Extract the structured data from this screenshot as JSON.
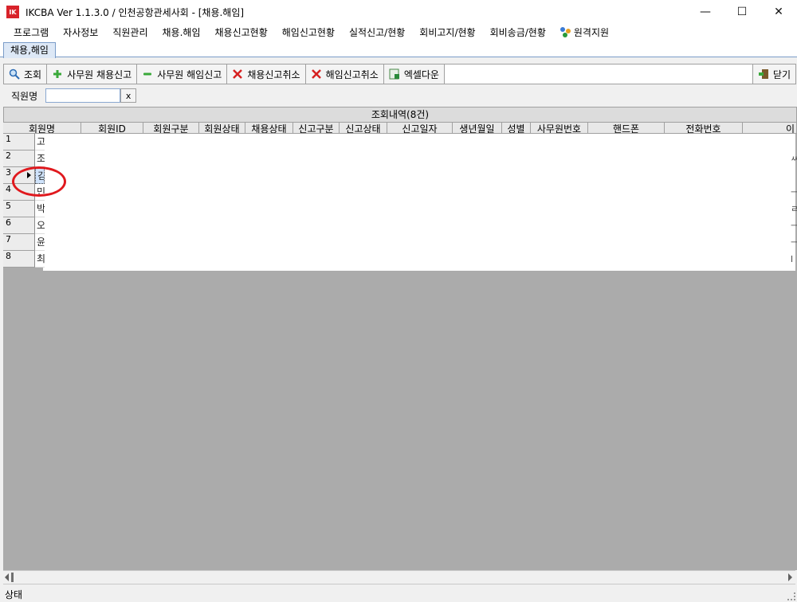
{
  "window": {
    "icon_text": "IK",
    "title": "IKCBA Ver 1.1.3.0 / 인천공항관세사회 - [채용.해임]",
    "minimize": "—",
    "maximize": "☐",
    "close": "✕"
  },
  "menu": [
    "프로그램",
    "자사정보",
    "직원관리",
    "채용.해임",
    "채용신고현황",
    "해임신고현황",
    "실적신고/현황",
    "회비고지/현황",
    "회비송금/현황"
  ],
  "menu_remote": "원격지원",
  "tab": "채용,해임",
  "toolbar": {
    "search": "조회",
    "hire": "사무원 채용신고",
    "dismiss": "사무원 해임신고",
    "cancel_hire": "채용신고취소",
    "cancel_dismiss": "해임신고취소",
    "excel": "엑셀다운",
    "close": "닫기"
  },
  "search": {
    "label": "직원명",
    "value": "",
    "clear": "x"
  },
  "grid": {
    "caption": "조회내역(8건)",
    "columns": [
      "회원명",
      "회원ID",
      "회원구분",
      "회원상태",
      "채용상태",
      "신고구분",
      "신고상태",
      "신고일자",
      "생년월일",
      "성별",
      "사무원번호",
      "핸드폰",
      "전화번호",
      "이"
    ],
    "rows": [
      {
        "num": "1",
        "name": "고",
        "right": ""
      },
      {
        "num": "2",
        "name": "조",
        "right": "ㅆ"
      },
      {
        "num": "3",
        "name": "김",
        "right": ""
      },
      {
        "num": "4",
        "name": "민",
        "right": "ㅡ"
      },
      {
        "num": "5",
        "name": "박",
        "right": "ㄹ"
      },
      {
        "num": "6",
        "name": "오",
        "right": "ㅡ"
      },
      {
        "num": "7",
        "name": "윤",
        "right": "ㅡ"
      },
      {
        "num": "8",
        "name": "최",
        "right": "l"
      }
    ],
    "selected_row": 3
  },
  "status": "상태",
  "colors": {
    "annotation_circle": "#e0191e",
    "selected_cell": "#cfe3fb",
    "app_icon": "#d8232a"
  }
}
